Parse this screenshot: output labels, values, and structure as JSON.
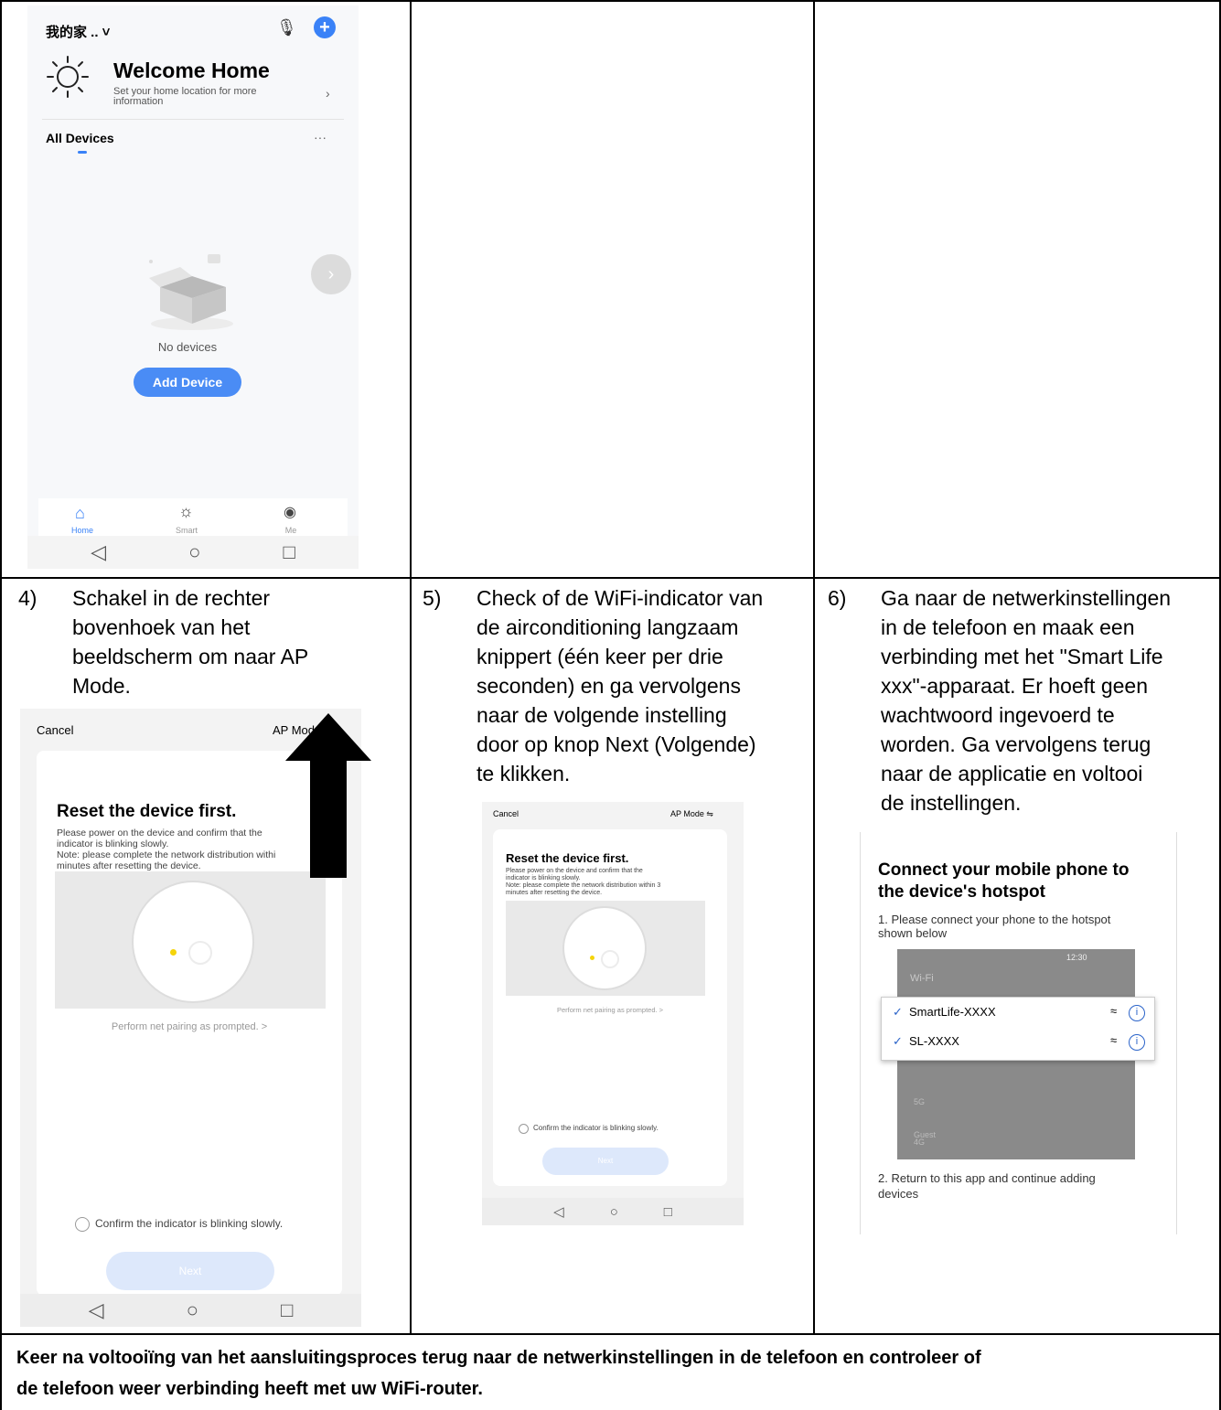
{
  "screen1": {
    "home_name": "我的家 .. ˅",
    "welcome_title": "Welcome Home",
    "welcome_sub_1": "Set your home location for more",
    "welcome_sub_2": "information",
    "all_devices": "All Devices",
    "more": "···",
    "no_devices": "No devices",
    "add_device": "Add Device",
    "tabs": [
      "Home",
      "Smart",
      "Me"
    ]
  },
  "steps": [
    {
      "num": "4)",
      "lines": [
        "Schakel in de rechter",
        "bovenhoek van het",
        "beeldscherm om naar AP",
        "Mode."
      ]
    },
    {
      "num": "5)",
      "lines": [
        "Check of de WiFi-indicator van",
        "de airconditioning langzaam",
        "knippert (één keer per drie",
        "seconden) en ga vervolgens",
        "naar de volgende instelling",
        "door op knop Next (Volgende)",
        "te klikken."
      ]
    },
    {
      "num": "6)",
      "lines": [
        "Ga naar de netwerkinstellingen",
        "in de telefoon en maak een",
        "verbinding met het \"Smart Life",
        "xxx\"-apparaat. Er hoeft geen",
        "wachtwoord ingevoerd te",
        "worden. Ga vervolgens terug",
        "naar de applicatie en voltooi",
        "de instellingen."
      ]
    }
  ],
  "reset_screen": {
    "cancel": "Cancel",
    "ap_mode": "AP Mode ⇋",
    "title": "Reset the device first.",
    "desc_1": "Please power on the device and confirm that the",
    "desc_2": "indicator is blinking slowly.",
    "desc_3a": "Note: please complete the network distribution withi",
    "desc_3b": "Note: please complete the network distribution within 3",
    "desc_4": "minutes after resetting the device.",
    "pairing": "Perform net pairing as prompted. >",
    "confirm": "Confirm the indicator is blinking slowly.",
    "next": "Next"
  },
  "hotspot": {
    "title_1": "Connect your mobile phone to",
    "title_2": "the device's hotspot",
    "step1_1": "1. Please connect your phone to the hotspot",
    "step1_2": "shown below",
    "wifi_header": "Wi-Fi",
    "time": "12:30",
    "networks_selected": [
      "SmartLife-XXXX",
      "SL-XXXX"
    ],
    "networks_other": [
      "5G",
      "Guest",
      "4G"
    ],
    "step2_1": "2. Return to this app and continue adding",
    "step2_2": "devices"
  },
  "footer": {
    "line1": "Keer na voltooiïng van het aansluitingsproces terug naar de netwerkinstellingen in de telefoon en controleer of",
    "line2": "de telefoon weer verbinding heeft met uw WiFi-router."
  }
}
